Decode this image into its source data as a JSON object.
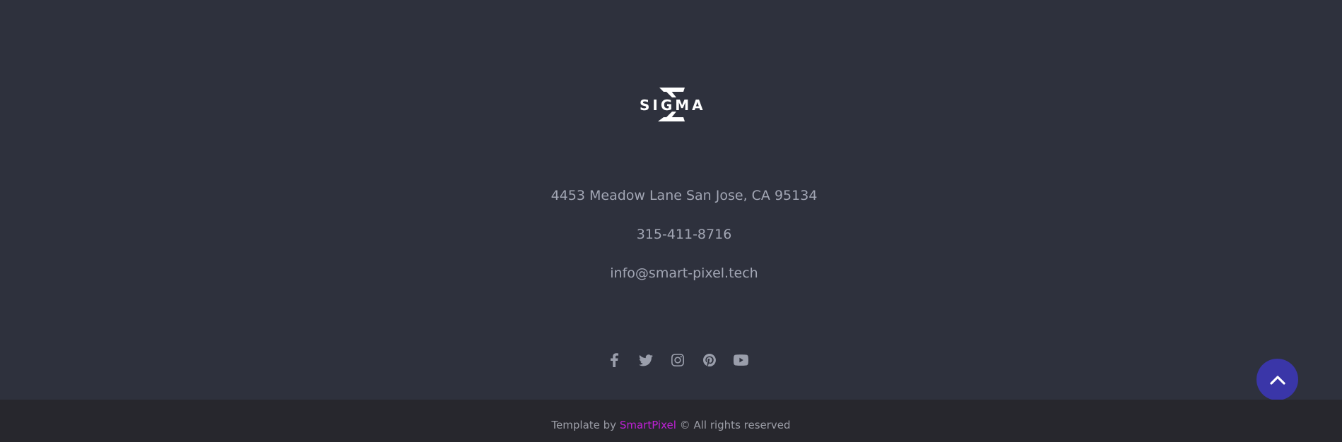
{
  "footer": {
    "logo": {
      "text": "SIGMA",
      "icon": "sigma-logo-icon"
    },
    "contact": {
      "address": "4453 Meadow Lane San Jose, CA 95134",
      "phone": "315-411-8716",
      "email": "info@smart-pixel.tech"
    },
    "socials": [
      {
        "name": "facebook",
        "icon": "facebook-icon"
      },
      {
        "name": "twitter",
        "icon": "twitter-icon"
      },
      {
        "name": "instagram",
        "icon": "instagram-icon"
      },
      {
        "name": "pinterest",
        "icon": "pinterest-icon"
      },
      {
        "name": "youtube",
        "icon": "youtube-icon"
      }
    ],
    "scroll_top": {
      "icon": "chevron-up-icon"
    }
  },
  "bottom_bar": {
    "prefix": "Template by",
    "brand": "SmartPixel",
    "suffix": "© All rights reserved"
  },
  "colors": {
    "background": "#2e313d",
    "bottom_bar": "#27272d",
    "text": "#a2a6b4",
    "accent_brand": "#c020d8",
    "scroll_button": "#3a36a8"
  }
}
